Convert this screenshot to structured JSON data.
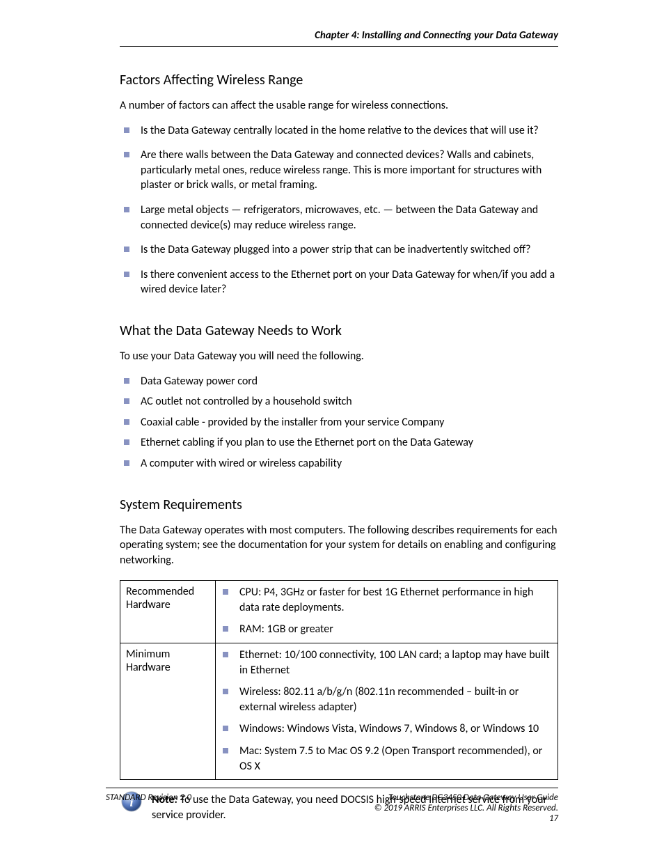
{
  "header": {
    "chapter_title": "Chapter 4: Installing and Connecting your Data Gateway"
  },
  "section1": {
    "title": "Factors Affecting Wireless Range",
    "intro": "A number of factors can affect the usable range for wireless connections.",
    "items": [
      "Is the Data Gateway centrally located in the home relative to the devices that will use it?",
      "Are there walls between the Data Gateway and connected devices? Walls and cabinets, particularly metal ones, reduce wireless range. This is more important for structures with plaster or brick walls, or metal framing.",
      "Large metal objects — refrigerators, microwaves, etc. — between the Data Gateway and connected device(s) may reduce wireless range.",
      "Is the Data Gateway plugged into a power strip that can be inadvertently switched off?",
      "Is there convenient access to the Ethernet port on your Data Gateway for when/if you add a wired device later?"
    ]
  },
  "section2": {
    "title": "What the Data Gateway Needs to Work",
    "intro": "To use your Data Gateway you will need the following.",
    "items": [
      "Data Gateway power cord",
      "AC outlet not controlled by a household switch",
      "Coaxial cable - provided by the installer from your service Company",
      "Ethernet cabling if you plan to use the Ethernet port on the Data Gateway",
      "A computer with wired or wireless capability"
    ]
  },
  "section3": {
    "title": "System Requirements",
    "intro": "The Data Gateway operates with most computers. The following describes requirements for each operating system; see the documentation for your system for details on enabling and configuring networking.",
    "table": {
      "row1_label": "Recommended Hardware",
      "row1_items": [
        "CPU: P4, 3GHz or faster for best 1G Ethernet performance in high data rate deployments.",
        "RAM: 1GB or greater"
      ],
      "row2_label": "Minimum Hardware",
      "row2_items": [
        "Ethernet: 10/100 connectivity, 100 LAN card; a laptop may have built in Ethernet",
        "Wireless: 802.11 a/b/g/n (802.11n recommended – built-in or external wireless adapter)",
        "Windows: Windows Vista, Windows 7, Windows 8, or Windows 10",
        "Mac: System 7.5 to Mac OS 9.2 (Open Transport recommended), or OS X"
      ]
    },
    "note_label": "Note:",
    "note_text": "To use the Data Gateway, you need DOCSIS high-speed Internet service from your service provider."
  },
  "footer": {
    "left": "STANDARD Revision 2.0",
    "right_line1": "Touchstone DG3450 Data Gateway User Guide",
    "right_line2": "© 2019 ARRIS Enterprises LLC. All Rights Reserved.",
    "page": "17"
  },
  "icons": {
    "info": "info-icon"
  }
}
